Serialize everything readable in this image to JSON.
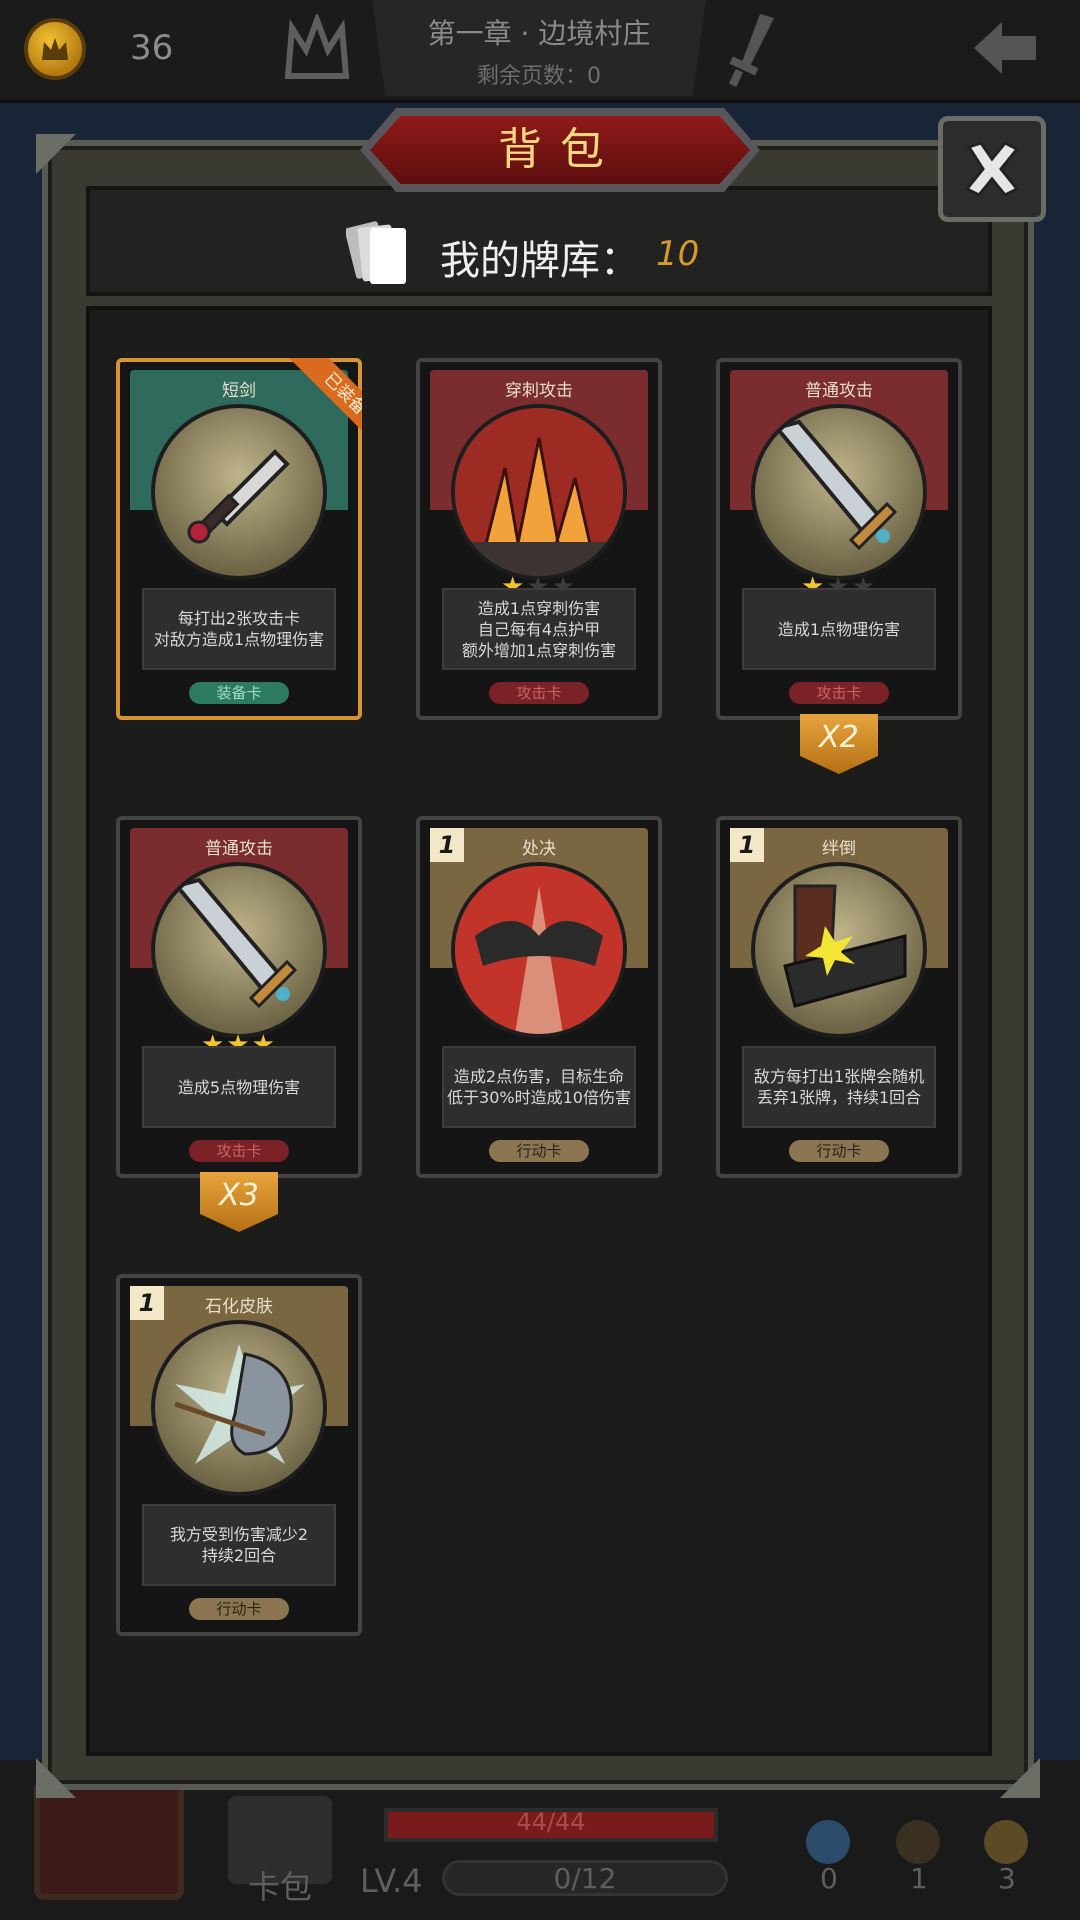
{
  "topbar": {
    "coins": "36",
    "chapter_title": "第一章 · 边境村庄",
    "pages_left": "剩余页数：0"
  },
  "modal": {
    "title": "背包",
    "deck_label": "我的牌库：",
    "deck_count": "10"
  },
  "cards": [
    {
      "name": "短剑",
      "desc": "每打出2张攻击卡\n对敌方造成1点物理伤害",
      "type": "装备卡",
      "ribbon": "已装备",
      "theme": "equip",
      "stars": null,
      "cost": null,
      "multiplier": null
    },
    {
      "name": "穿刺攻击",
      "desc": "造成1点穿刺伤害\n自己每有4点护甲\n额外增加1点穿刺伤害",
      "type": "攻击卡",
      "ribbon": null,
      "theme": "attack",
      "stars": 1,
      "cost": null,
      "multiplier": null
    },
    {
      "name": "普通攻击",
      "desc": "造成1点物理伤害",
      "type": "攻击卡",
      "ribbon": null,
      "theme": "attack",
      "stars": 1,
      "cost": null,
      "multiplier": "X2"
    },
    {
      "name": "普通攻击",
      "desc": "造成5点物理伤害",
      "type": "攻击卡",
      "ribbon": null,
      "theme": "attack",
      "stars": 3,
      "cost": null,
      "multiplier": "X3"
    },
    {
      "name": "处决",
      "desc": "造成2点伤害，目标生命\n低于30%时造成10倍伤害",
      "type": "行动卡",
      "ribbon": null,
      "theme": "action",
      "stars": null,
      "cost": "1",
      "multiplier": null
    },
    {
      "name": "绊倒",
      "desc": "敌方每打出1张牌会随机\n丢弃1张牌，持续1回合",
      "type": "行动卡",
      "ribbon": null,
      "theme": "action",
      "stars": null,
      "cost": "1",
      "multiplier": null
    },
    {
      "name": "石化皮肤",
      "desc": "我方受到伤害减少2\n持续2回合",
      "type": "行动卡",
      "ribbon": null,
      "theme": "action",
      "stars": null,
      "cost": "1",
      "multiplier": null
    }
  ],
  "bottombar": {
    "cardpack_label": "卡包",
    "level": "LV.4",
    "hp": "44/44",
    "xp": "0/12",
    "potions": "0",
    "hourglass": "1",
    "scrolls": "3"
  },
  "colors": {
    "equip_top": "#2f6b5c",
    "attack_top": "#7a2c2e",
    "action_top": "#7a6640",
    "equip_pill": "#2d7a63",
    "attack_pill": "#7a2227",
    "action_pill": "#8c7652"
  }
}
